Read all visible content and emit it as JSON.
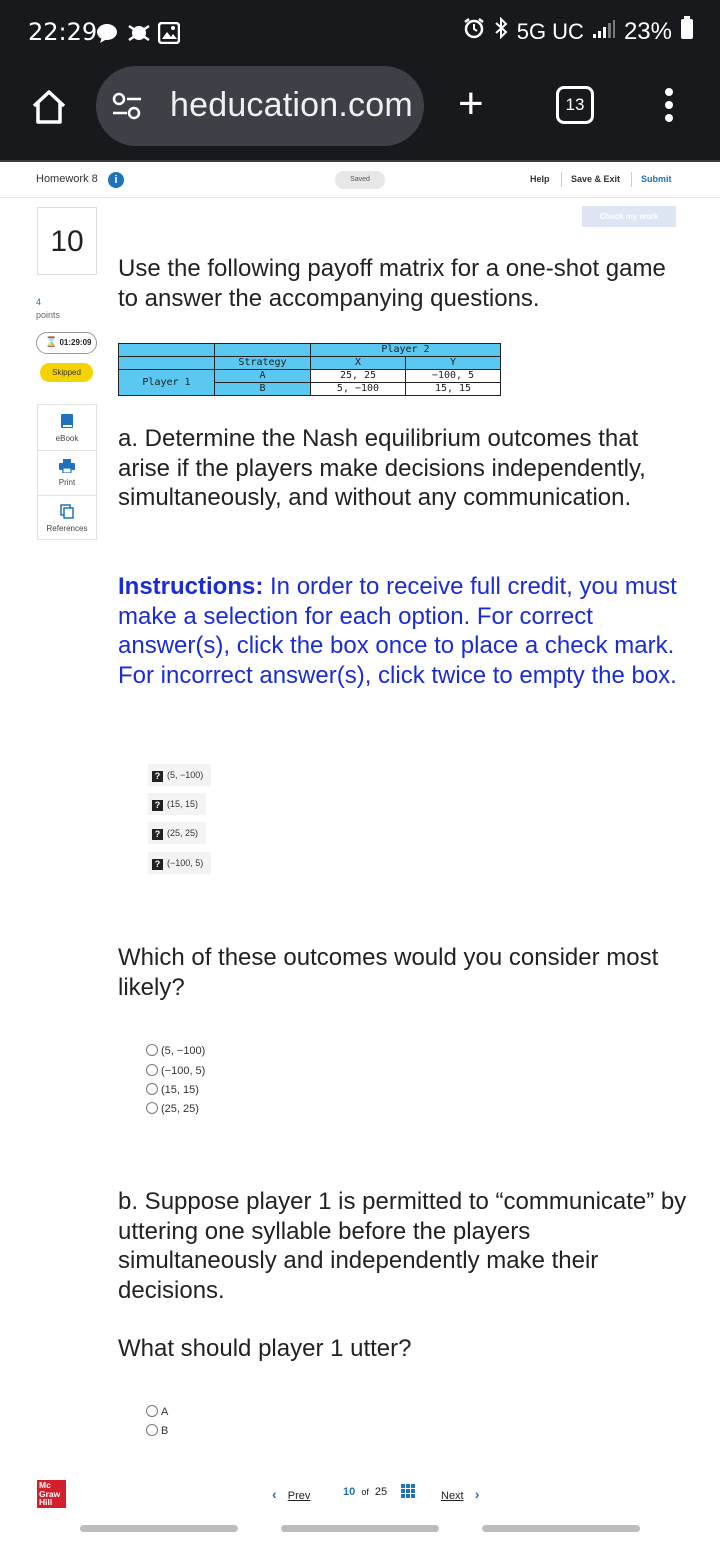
{
  "status_bar": {
    "time": "22:29",
    "network": "5G UC",
    "battery": "23%"
  },
  "browser": {
    "url": "heducation.com",
    "tab_count": "13"
  },
  "header": {
    "homework": "Homework 8",
    "saved": "Saved",
    "help": "Help",
    "save_exit": "Save & Exit",
    "submit": "Submit",
    "check_work": "Check my work"
  },
  "rail": {
    "question_number": "10",
    "points_value": "4",
    "points_label": "points",
    "timer": "01:29:09",
    "status": "Skipped",
    "tools": [
      "eBook",
      "Print",
      "References"
    ]
  },
  "question": {
    "intro": "Use the following payoff matrix for a one-shot game to answer the accompanying questions.",
    "matrix": {
      "player2": "Player 2",
      "player1": "Player 1",
      "strategy": "Strategy",
      "col_x": "X",
      "col_y": "Y",
      "row_a": "A",
      "row_b": "B",
      "a_x": "25, 25",
      "a_y": "−100, 5",
      "b_x": "5, −100",
      "b_y": "15, 15"
    },
    "part_a": "a. Determine the Nash equilibrium outcomes that arise if the players make decisions independently, simultaneously, and without any communication.",
    "instructions_label": "Instructions:",
    "instructions_text": " In order to receive full credit, you must make a selection for each option. For correct answer(s), click the box once to place a check mark. For incorrect answer(s), click twice to empty the box.",
    "checkbox_options": [
      "(5, −100)",
      "(15, 15)",
      "(25, 25)",
      "(−100, 5)"
    ],
    "likely_prompt": "Which of these outcomes would you consider most likely?",
    "likely_options": [
      "(5, −100)",
      "(−100, 5)",
      "(15, 15)",
      "(25, 25)"
    ],
    "part_b": "b. Suppose player 1 is permitted to “communicate” by uttering one syllable before the players simultaneously and independently make their decisions.",
    "utter_prompt": "What should player 1 utter?",
    "utter_options": [
      "A",
      "B"
    ]
  },
  "footer": {
    "logo": [
      "Mc",
      "Graw",
      "Hill"
    ],
    "prev": "Prev",
    "current": "10",
    "of": "of",
    "total": "25",
    "next": "Next"
  }
}
